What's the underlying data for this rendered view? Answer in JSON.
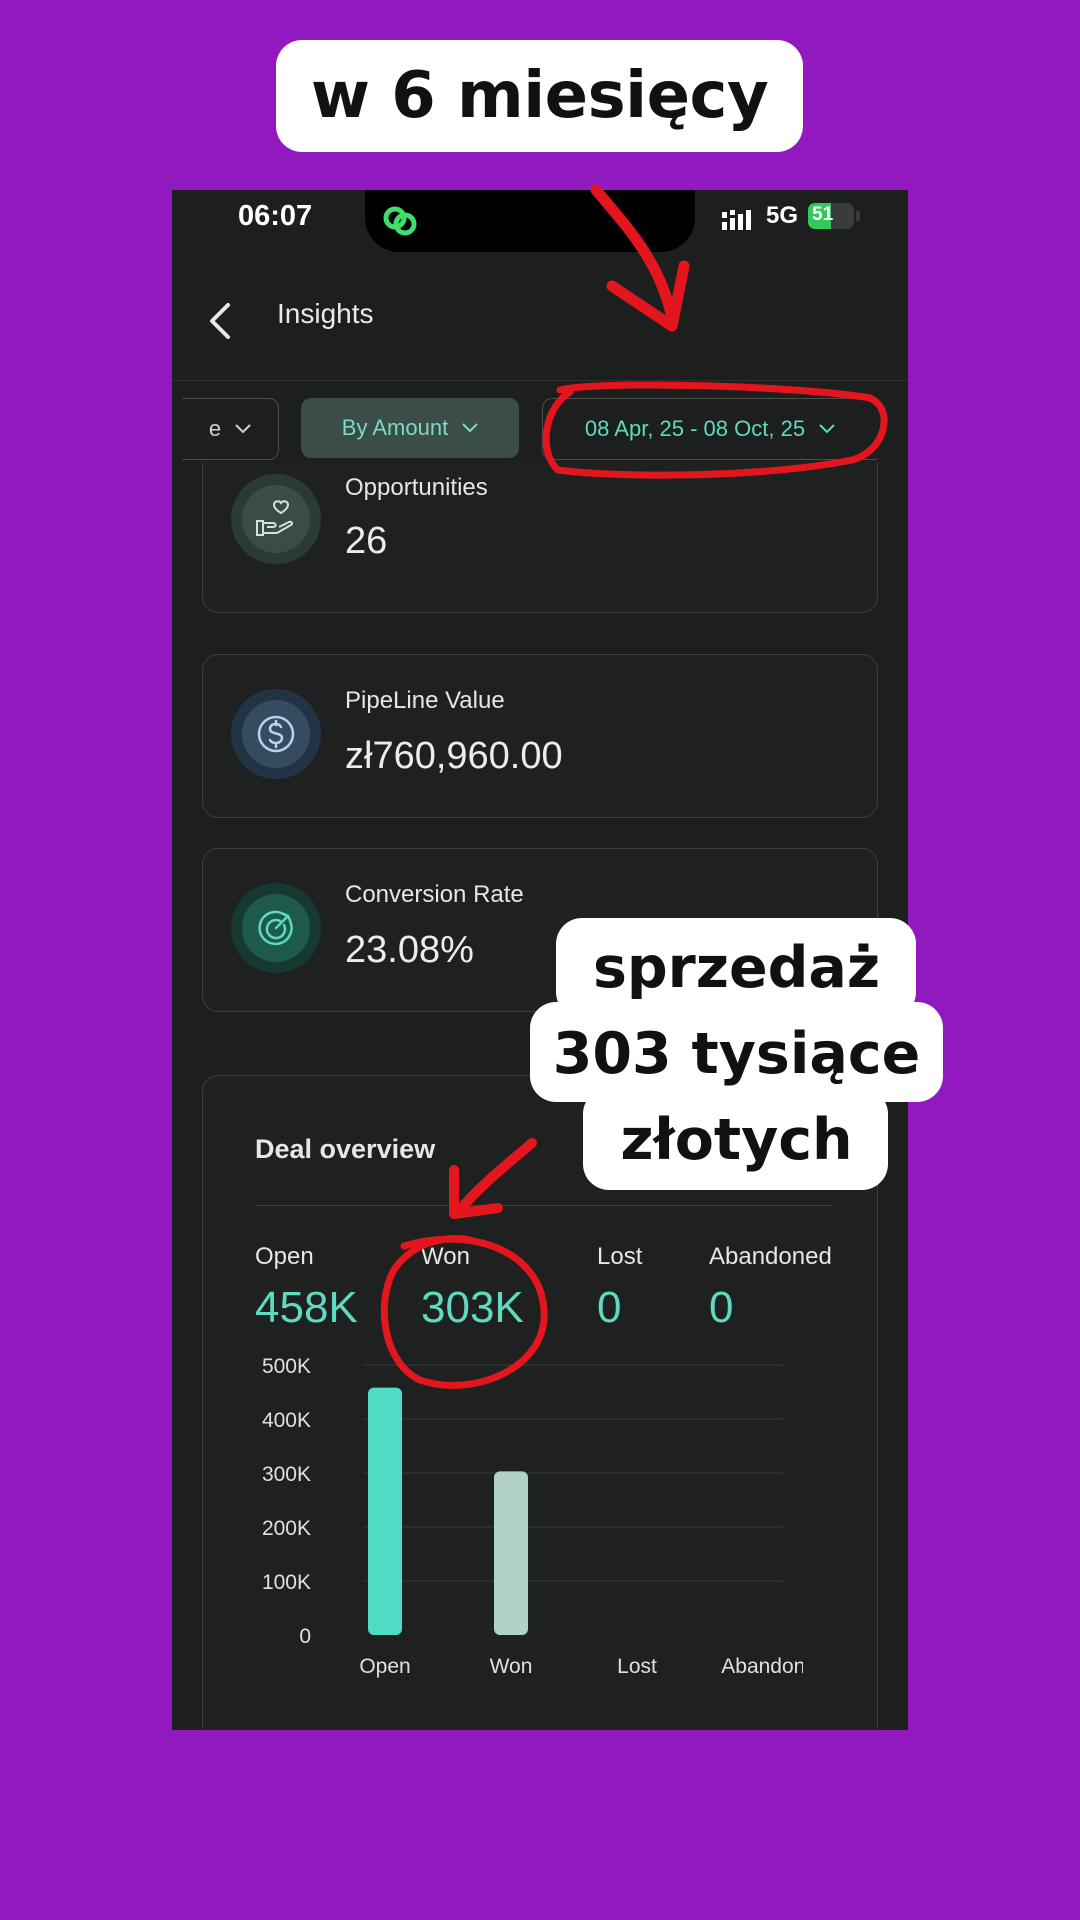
{
  "headline": "w 6 miesięcy",
  "status_bar": {
    "time": "06:07",
    "network": "5G",
    "battery_level": 51,
    "battery_text": "51"
  },
  "header": {
    "title": "Insights"
  },
  "filters": [
    {
      "label": "e"
    },
    {
      "label": "By Amount"
    },
    {
      "label": "08 Apr, 25 - 08 Oct, 25"
    }
  ],
  "metrics": [
    {
      "label": "Opportunities",
      "value": "26",
      "icon": "hand-heart-icon"
    },
    {
      "label": "PipeLine Value",
      "value": "zł760,960.00",
      "icon": "dollar-coin-icon"
    },
    {
      "label": "Conversion Rate",
      "value": "23.08%",
      "icon": "target-icon"
    }
  ],
  "deal_overview": {
    "title": "Deal overview",
    "stats": [
      {
        "label": "Open",
        "value": "458K"
      },
      {
        "label": "Won",
        "value": "303K"
      },
      {
        "label": "Lost",
        "value": "0"
      },
      {
        "label": "Abandoned",
        "value": "0"
      }
    ]
  },
  "chart_data": {
    "type": "bar",
    "categories": [
      "Open",
      "Won",
      "Lost",
      "Abandoned"
    ],
    "values": [
      458000,
      303000,
      0,
      0
    ],
    "bar_colors": [
      "#4fdcc4",
      "#b2d1c7",
      "#4fdcc4",
      "#4fdcc4"
    ],
    "yticks": [
      {
        "value": 0,
        "label": "0"
      },
      {
        "value": 100000,
        "label": "100K"
      },
      {
        "value": 200000,
        "label": "200K"
      },
      {
        "value": 300000,
        "label": "300K"
      },
      {
        "value": 400000,
        "label": "400K"
      },
      {
        "value": 500000,
        "label": "500K"
      }
    ],
    "ylim": [
      0,
      500000
    ],
    "grid": true
  },
  "annotation": {
    "lines": [
      "sprzedaż",
      "303 tysiące",
      "złotych"
    ]
  },
  "colors": {
    "background": "#9218bf",
    "accent": "#5fd9c0",
    "annotation_red": "#e3161d"
  }
}
